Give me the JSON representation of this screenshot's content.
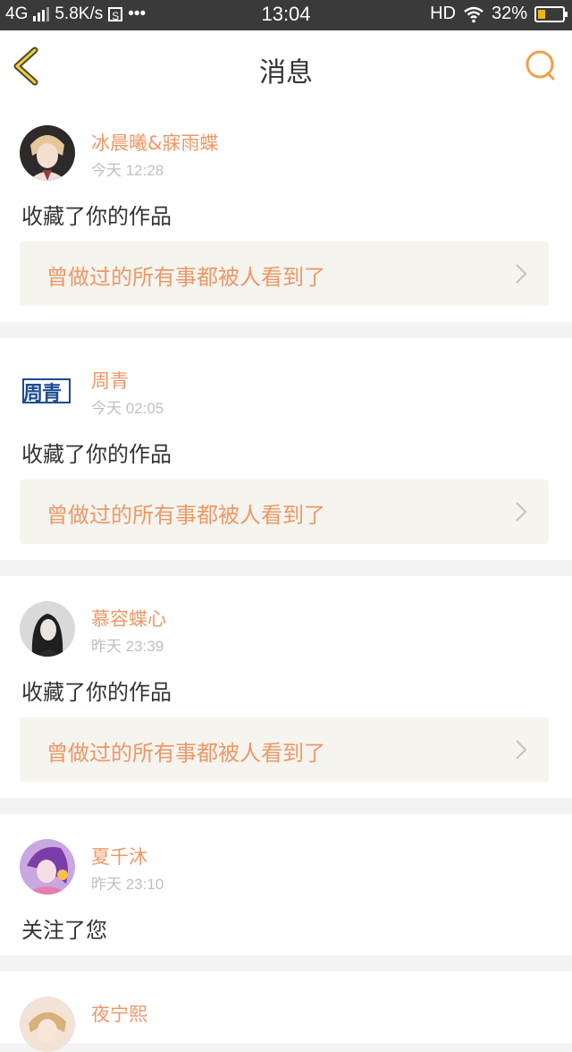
{
  "status_bar": {
    "network": "4G",
    "speed": "5.8K/s",
    "s_icon_label": "S",
    "more": "•••",
    "time": "13:04",
    "hd": "HD",
    "battery_text": "32%",
    "battery_level": 0.32,
    "battery_color": "#f2b311"
  },
  "header": {
    "title": "消息",
    "back_icon": "chevron-left-icon",
    "search_icon": "search-icon",
    "accent_color": "#f0a04b"
  },
  "messages": [
    {
      "user": "冰晨曦&寐雨蝶",
      "time": "今天 12:28",
      "action": "收藏了你的作品",
      "work_title": "曾做过的所有事都被人看到了"
    },
    {
      "user": "周青",
      "avatar_text": "周青",
      "time": "今天 02:05",
      "action": "收藏了你的作品",
      "work_title": "曾做过的所有事都被人看到了"
    },
    {
      "user": "慕容蝶心",
      "time": "昨天 23:39",
      "action": "收藏了你的作品",
      "work_title": "曾做过的所有事都被人看到了"
    },
    {
      "user": "夏千沐",
      "time": "昨天 23:10",
      "action": "关注了您"
    },
    {
      "user": "夜宁熙"
    }
  ],
  "colors": {
    "username": "#ec9867",
    "work_bg": "#f5f4ee",
    "time": "#bfbfbf"
  }
}
